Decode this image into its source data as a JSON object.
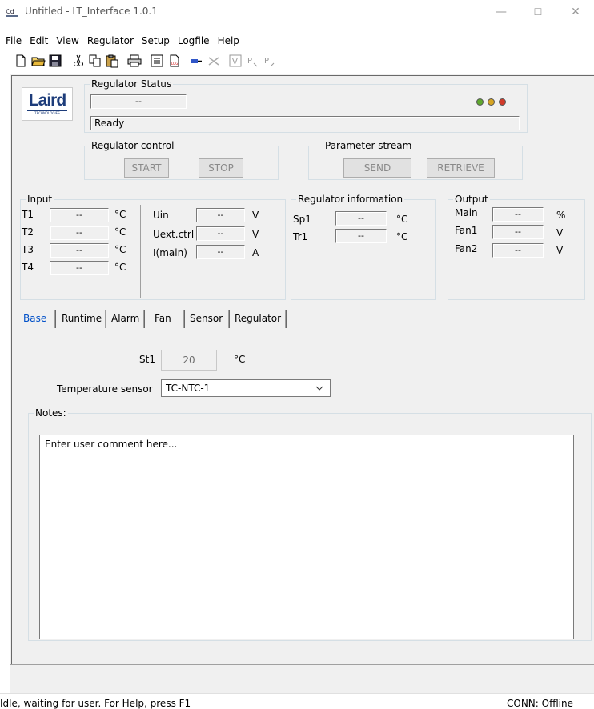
{
  "window": {
    "title": "Untitled - LT_Interface 1.0.1",
    "minimize": "—",
    "maximize": "☐",
    "close": "✕"
  },
  "menu": [
    "File",
    "Edit",
    "View",
    "Regulator",
    "Setup",
    "Logfile",
    "Help"
  ],
  "toolbar": {
    "icons": [
      "new-file-icon",
      "open-folder-icon",
      "save-icon",
      "cut-icon",
      "copy-icon",
      "paste-icon",
      "print-icon",
      "list-icon",
      "log-icon",
      "connect-icon",
      "disconnect-icon",
      "verify-icon",
      "parameter-send-icon",
      "parameter-retrieve-icon"
    ],
    "log_label": "LOG",
    "verify_label": "V",
    "p_send_label": "P",
    "p_retrieve_label": "P"
  },
  "logo": {
    "text": "Laird",
    "subtext": "TECHNOLOGIES"
  },
  "regulator_status": {
    "legend": "Regulator Status",
    "field1": "--",
    "field2": "--",
    "status": "Ready",
    "led_colors": [
      "#5fa82e",
      "#d6a422",
      "#d23a2a"
    ]
  },
  "regulator_control": {
    "legend": "Regulator control",
    "start": "START",
    "stop": "STOP"
  },
  "parameter_stream": {
    "legend": "Parameter stream",
    "send": "SEND",
    "retrieve": "RETRIEVE"
  },
  "input": {
    "legend": "Input",
    "temps": [
      {
        "label": "T1",
        "value": "--",
        "unit": "°C"
      },
      {
        "label": "T2",
        "value": "--",
        "unit": "°C"
      },
      {
        "label": "T3",
        "value": "--",
        "unit": "°C"
      },
      {
        "label": "T4",
        "value": "--",
        "unit": "°C"
      }
    ],
    "electrical": [
      {
        "label": "Uin",
        "value": "--",
        "unit": "V"
      },
      {
        "label": "Uext.ctrl",
        "value": "--",
        "unit": "V"
      },
      {
        "label": "I(main)",
        "value": "--",
        "unit": "A"
      }
    ]
  },
  "regulator_information": {
    "legend": "Regulator information",
    "rows": [
      {
        "label": "Sp1",
        "value": "--",
        "unit": "°C"
      },
      {
        "label": "Tr1",
        "value": "--",
        "unit": "°C"
      }
    ]
  },
  "output": {
    "legend": "Output",
    "rows": [
      {
        "label": "Main",
        "value": "--",
        "unit": "%"
      },
      {
        "label": "Fan1",
        "value": "--",
        "unit": "V"
      },
      {
        "label": "Fan2",
        "value": "--",
        "unit": "V"
      }
    ]
  },
  "tabs": [
    "Base",
    "Runtime",
    "Alarm",
    "Fan",
    "Sensor",
    "Regulator"
  ],
  "active_tab": "Base",
  "base_tab": {
    "st1_label": "St1",
    "st1_value": "20",
    "st1_unit": "°C",
    "sensor_label": "Temperature sensor",
    "sensor_value": "TC-NTC-1",
    "notes_legend": "Notes:",
    "notes_text": "Enter user comment here..."
  },
  "statusbar": {
    "left": "Idle, waiting for user. For Help, press F1",
    "right": "CONN: Offline"
  },
  "colors": {
    "accent_tab": "#0050c8",
    "panel_bg": "#f0f0f0"
  }
}
